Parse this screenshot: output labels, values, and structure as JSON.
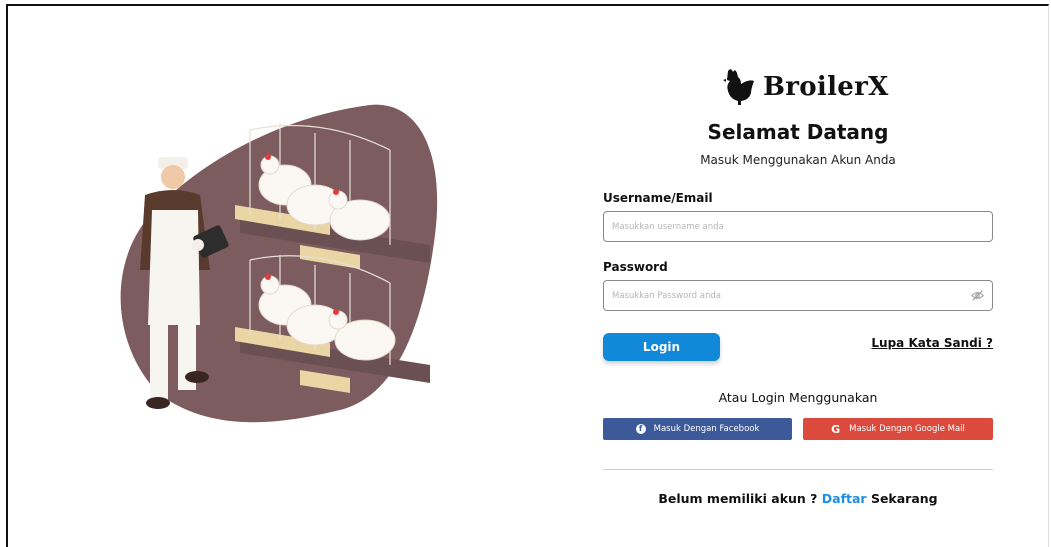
{
  "brand": {
    "name": "BroilerX",
    "logo_icon": "rooster-icon"
  },
  "welcome": {
    "title": "Selamat Datang",
    "subtitle": "Masuk Menggunakan Akun Anda"
  },
  "form": {
    "username_label": "Username/Email",
    "username_placeholder": "Masukkan username anda",
    "username_value": "",
    "password_label": "Password",
    "password_placeholder": "Masukkan Password anda",
    "password_value": "",
    "password_toggle_icon": "eye-slash-icon",
    "login_label": "Login",
    "forgot_label": "Lupa Kata Sandi ?"
  },
  "alt_login": {
    "heading": "Atau Login Menggunakan",
    "facebook_label": "Masuk Dengan Facebook",
    "facebook_icon": "facebook-icon",
    "google_label": "Masuk Dengan Google Mail",
    "google_icon": "google-icon"
  },
  "signup": {
    "prefix": "Belum memiliki akun ?",
    "link": "Daftar",
    "suffix": "Sekarang"
  },
  "colors": {
    "primary": "#1188d8",
    "facebook": "#3c5a99",
    "google": "#dc4a3d",
    "link": "#1b8fe6",
    "illustration_blob": "#7c5c5e"
  }
}
